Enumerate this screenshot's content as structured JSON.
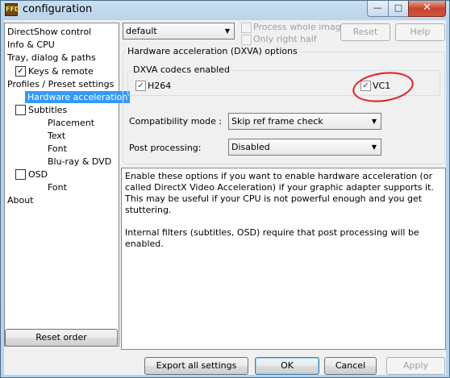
{
  "window": {
    "title": "configuration",
    "icon_text": "FFD"
  },
  "tree": {
    "items": [
      {
        "label": "DirectShow control",
        "check": ""
      },
      {
        "label": "Info & CPU",
        "check": ""
      },
      {
        "label": "Tray, dialog & paths",
        "check": ""
      },
      {
        "label": "Keys & remote",
        "check": "✓"
      },
      {
        "label": "Profiles / Preset settings",
        "check": ""
      },
      {
        "label": "Hardware acceleration",
        "check": ""
      },
      {
        "label": "Subtitles",
        "check": ""
      },
      {
        "label": "Placement",
        "check": ""
      },
      {
        "label": "Text",
        "check": ""
      },
      {
        "label": "Font",
        "check": ""
      },
      {
        "label": "Blu-ray & DVD",
        "check": ""
      },
      {
        "label": "OSD",
        "check": ""
      },
      {
        "label": "Font",
        "check": ""
      },
      {
        "label": "About",
        "check": ""
      }
    ]
  },
  "preset": {
    "value": "default"
  },
  "options": {
    "process_whole_image": "Process whole image",
    "only_right_half": "Only right half",
    "reset": "Reset",
    "help": "Help"
  },
  "hwaccel": {
    "group_title": "Hardware acceleration (DXVA) options",
    "codecs_title": "DXVA codecs enabled",
    "h264": "H264",
    "vc1": "VC1",
    "check_mark": "✓",
    "compat_label": "Compatibility mode :",
    "compat_value": "Skip ref frame check",
    "post_label": "Post processing:",
    "post_value": "Disabled"
  },
  "description": {
    "p1": "Enable these options if you want to enable hardware acceleration (or called DirectX Video Acceleration) if your graphic adapter supports it. This may be useful if your CPU is not powerful enough and you get stuttering.",
    "p2": "Internal filters (subtitles, OSD) require that post processing will be enabled."
  },
  "footer": {
    "reset_order": "Reset order",
    "export": "Export all settings",
    "ok": "OK",
    "cancel": "Cancel",
    "apply": "Apply"
  },
  "window_controls": {
    "minimize": "—",
    "maximize": "□",
    "close": "✕"
  },
  "colors": {
    "selection": "#3399ff",
    "annotation": "#e02020"
  }
}
